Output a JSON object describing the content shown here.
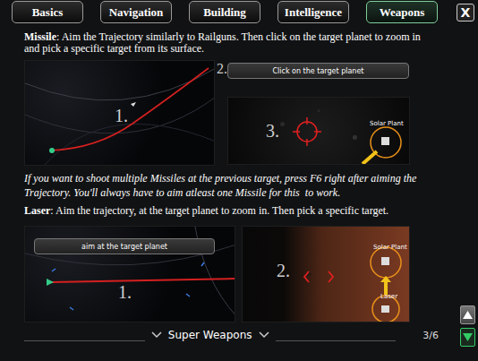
{
  "tabs": [
    {
      "label": "Basics",
      "selected": false
    },
    {
      "label": "Navigation",
      "selected": false
    },
    {
      "label": "Building",
      "selected": false
    },
    {
      "label": "Intelligence",
      "selected": false
    },
    {
      "label": "Weapons",
      "selected": true
    }
  ],
  "close": "X",
  "missile": {
    "title": "Missile",
    "text": ": Aim the Trajectory similarly to Railguns. Then click on the target planet to zoom in and pick a specific target from its surface.",
    "step1": {
      "label": "1."
    },
    "step2": {
      "label": "2.",
      "hint": "Click on the target planet"
    },
    "step3": {
      "label": "3.",
      "building": "Solar Plant"
    }
  },
  "note": "If you want to shoot multiple Missiles at the previous target, press F6 right after aiming the Trajectory. You'll always have to aim atleast one Missile for this  to work.",
  "laser": {
    "title": "Laser",
    "text": ": Aim the trajectory, at the target planet to zoom in. Then pick a specific target.",
    "step1": {
      "label": "1.",
      "hint": "aim at the target planet"
    },
    "step2": {
      "label": "2.",
      "buildings": [
        "Solar Plant",
        "Laser"
      ]
    }
  },
  "footer": {
    "category": "Super Weapons",
    "page": "3/6"
  }
}
